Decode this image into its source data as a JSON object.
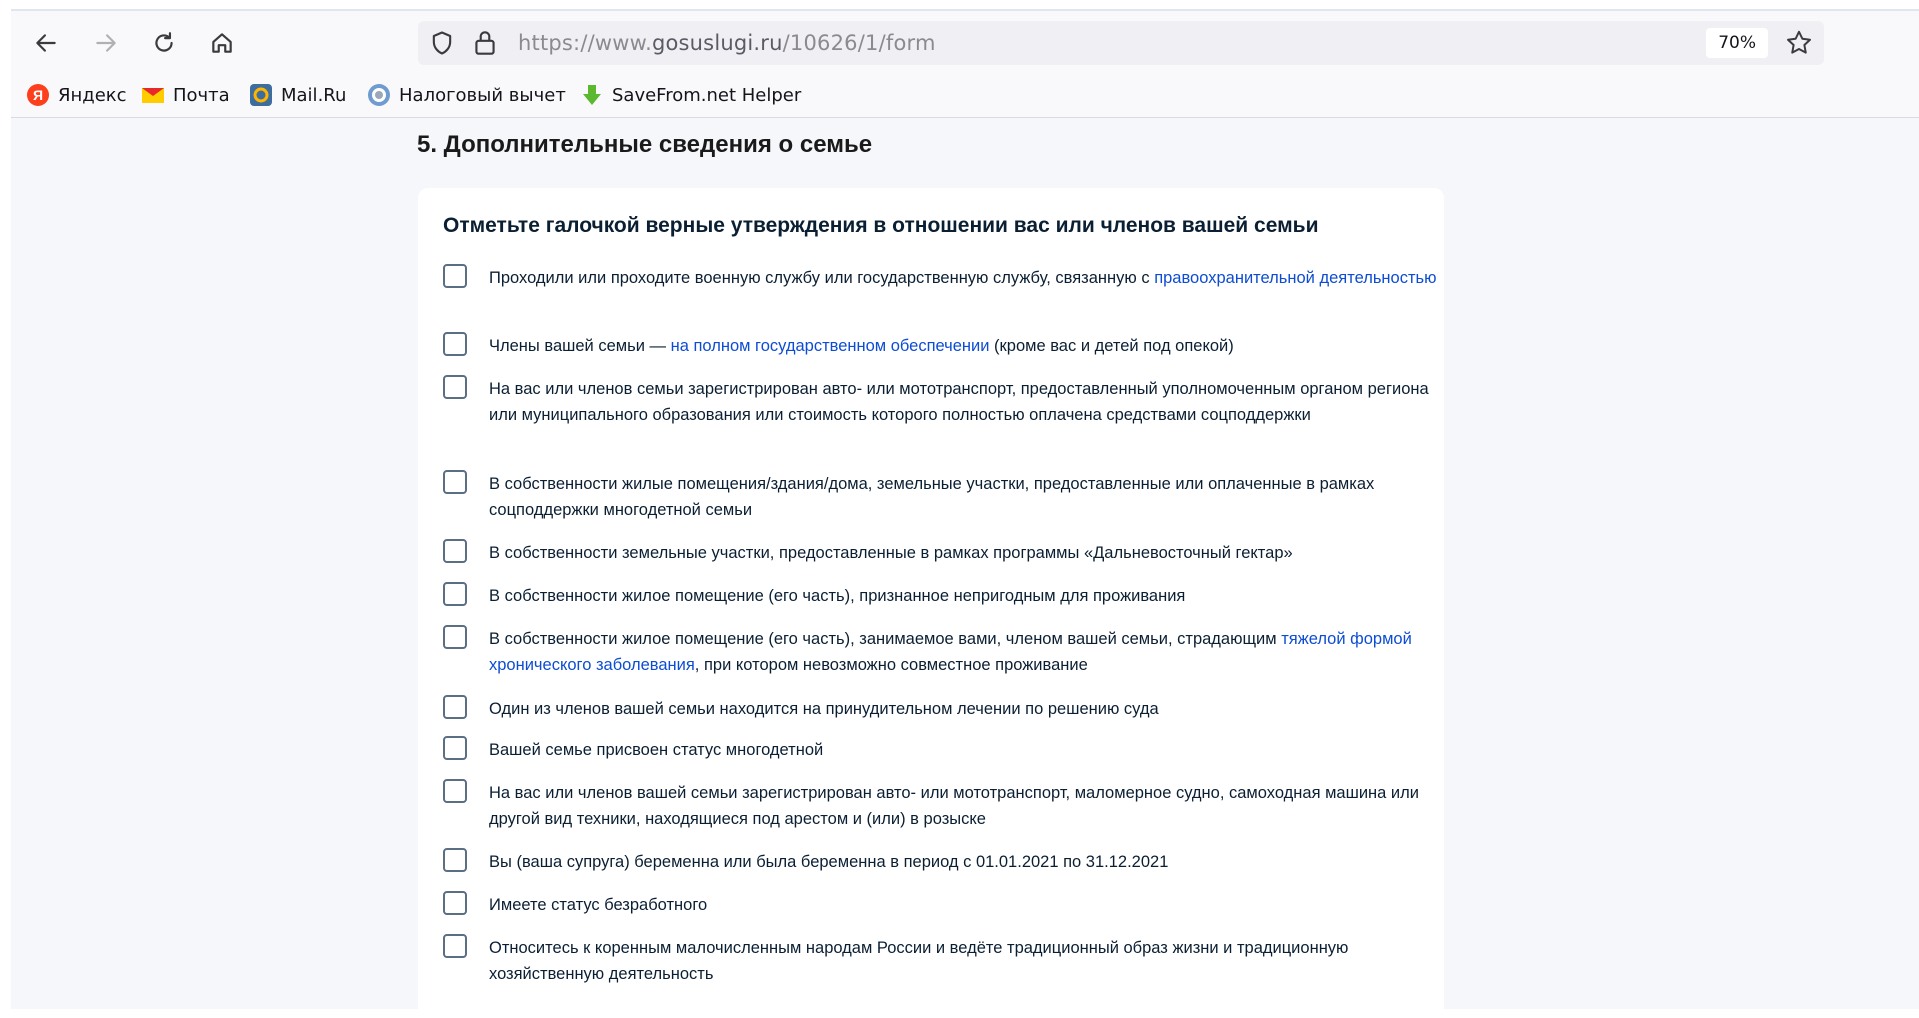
{
  "browser": {
    "url_prefix": "https://www.",
    "url_host": "gosuslugi.ru",
    "url_path": "/10626/1/form",
    "zoom": "70%"
  },
  "bookmarks": [
    {
      "label": "Яндекс",
      "icon": "yandex-icon"
    },
    {
      "label": "Почта",
      "icon": "mail-envelope-icon"
    },
    {
      "label": "Mail.Ru",
      "icon": "mailru-icon"
    },
    {
      "label": "Налоговый вычет",
      "icon": "tax-site-icon"
    },
    {
      "label": "SaveFrom.net Helper",
      "icon": "download-arrow-icon"
    }
  ],
  "section": {
    "title": "5. Дополнительные сведения о семье"
  },
  "card": {
    "title": "Отметьте галочкой верные утверждения в отношении вас или членов вашей семьи"
  },
  "items": [
    {
      "pre": "Проходили или проходите военную службу или государственную службу, связанную с ",
      "link": "правоохранительной деятельностью",
      "post": ""
    },
    {
      "pre": "Члены вашей семьи — ",
      "link": "на полном государственном обеспечении",
      "post": " (кроме вас и детей под опекой)"
    },
    {
      "pre": "На вас или членов семьи зарегистрирован авто- или мототранспорт, предоставленный уполномоченным органом региона или муниципального образования или стоимость которого полностью оплачена средствами соцподдержки",
      "link": "",
      "post": ""
    },
    {
      "pre": "В собственности жилые помещения/здания/дома, земельные участки, предоставленные или оплаченные в рамках соцподдержки многодетной семьи",
      "link": "",
      "post": ""
    },
    {
      "pre": "В собственности земельные участки, предоставленные в рамках программы «Дальневосточный гектар»",
      "link": "",
      "post": ""
    },
    {
      "pre": "В собственности жилое помещение (его часть), признанное непригодным для проживания",
      "link": "",
      "post": ""
    },
    {
      "pre": "В собственности жилое помещение (его часть), занимаемое вами, членом вашей семьи, страдающим ",
      "link": "тяжелой формой хронического заболевания",
      "post": ", при котором невозможно совместное проживание"
    },
    {
      "pre": "Один из членов вашей семьи находится на принудительном лечении по решению суда",
      "link": "",
      "post": ""
    },
    {
      "pre": "Вашей семье присвоен статус многодетной",
      "link": "",
      "post": ""
    },
    {
      "pre": "На вас или членов вашей семьи зарегистрирован авто- или мототранспорт, маломерное судно, самоходная машина или другой вид техники, находящиеся под арестом и (или) в розыске",
      "link": "",
      "post": ""
    },
    {
      "pre": "Вы (ваша супруга) беременна или была беременна в период с 01.01.2021 по 31.12.2021",
      "link": "",
      "post": ""
    },
    {
      "pre": "Имеете статус безработного",
      "link": "",
      "post": ""
    },
    {
      "pre": "Относитесь к коренным малочисленным народам России и ведёте традиционный образ жизни и традиционную хозяйственную деятельность",
      "link": "",
      "post": ""
    }
  ]
}
